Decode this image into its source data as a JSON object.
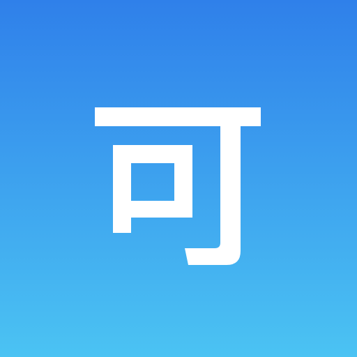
{
  "icon": {
    "glyph": "可",
    "glyph_color": "#ffffff",
    "background": {
      "top_color": "#2f80ea",
      "bottom_color": "#4bc3f3"
    }
  }
}
